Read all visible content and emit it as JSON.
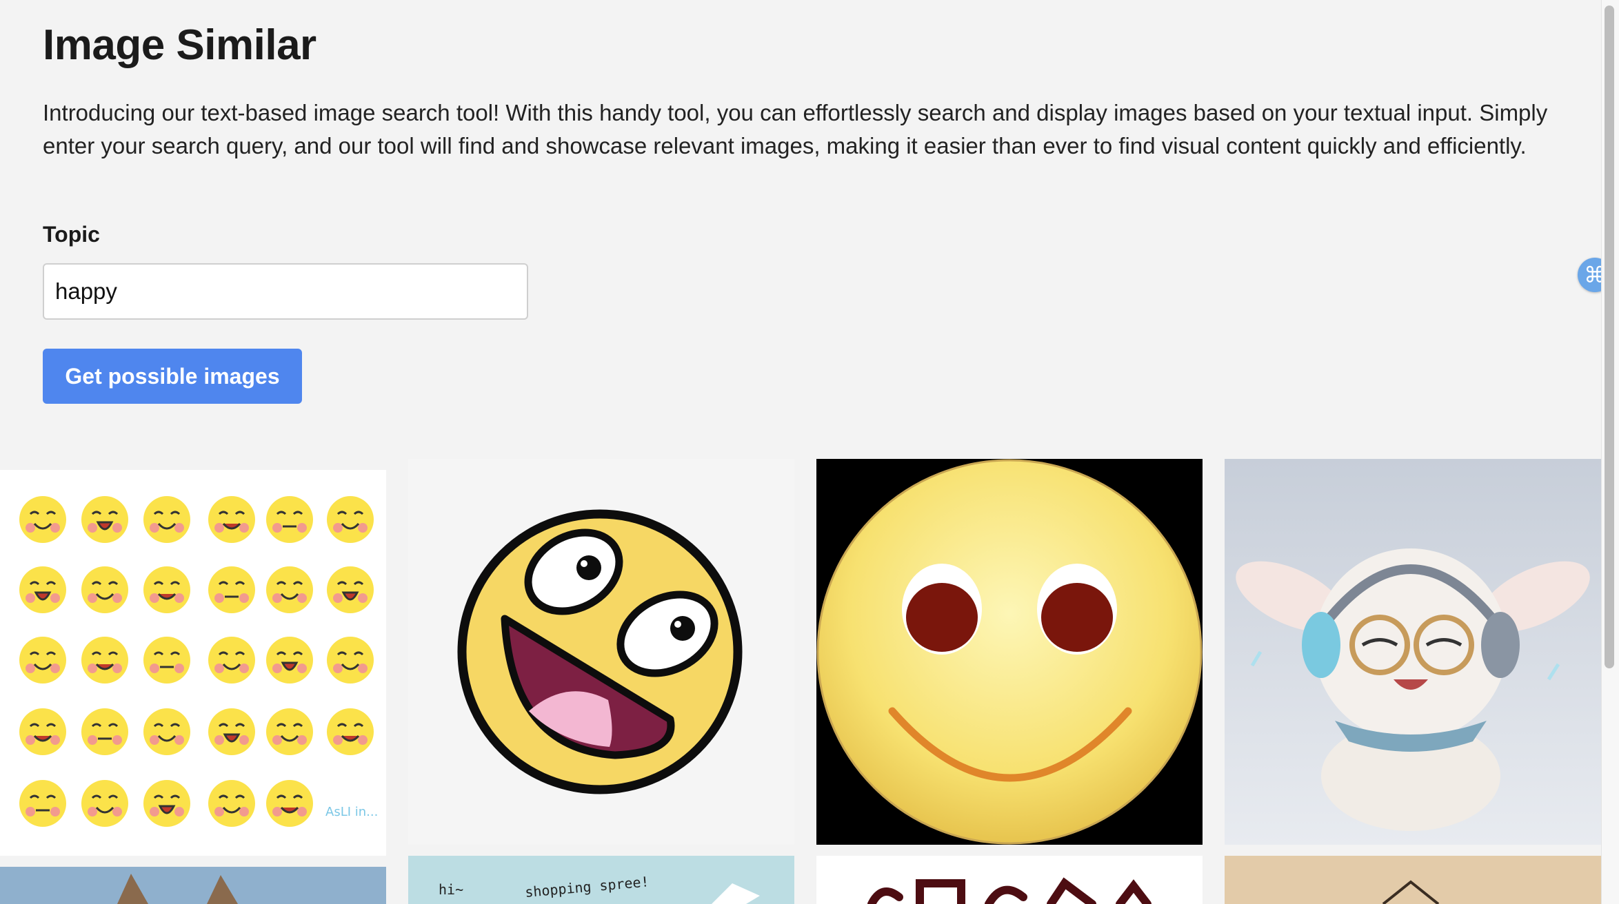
{
  "page": {
    "title": "Image Similar",
    "intro": "Introducing our text-based image search tool! With this handy tool, you can effortlessly search and display images based on your textual input. Simply enter your search query, and our tool will find and showcase relevant images, making it easier than ever to find visual content quickly and efficiently."
  },
  "form": {
    "topic_label": "Topic",
    "topic_value": "happy",
    "submit_label": "Get possible images"
  },
  "results": {
    "tiles": [
      {
        "name": "emoji-sheet-image",
        "watermark": "AsLI in..."
      },
      {
        "name": "awesome-face-image"
      },
      {
        "name": "smiley-face-image"
      },
      {
        "name": "rabbit-headphones-image"
      },
      {
        "name": "dog-photo-image"
      },
      {
        "name": "shopping-card-image",
        "caption_1": "hi~",
        "caption_2": "shopping spree!"
      },
      {
        "name": "chinese-text-image"
      },
      {
        "name": "paper-craft-image"
      }
    ]
  },
  "overlay": {
    "icon": "command-icon",
    "glyph": "⌘"
  },
  "colors": {
    "accent": "#4f86ee",
    "background": "#f3f3f3",
    "emoji_yellow": "#fbe24a"
  }
}
